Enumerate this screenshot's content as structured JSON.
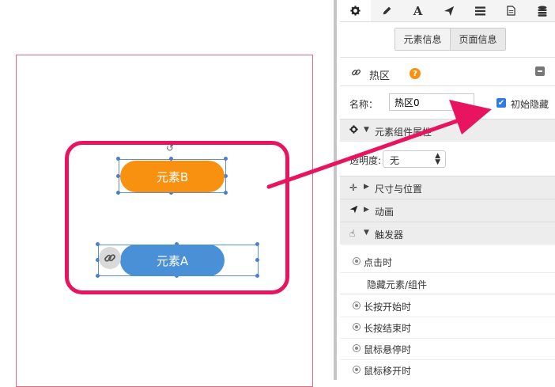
{
  "canvas": {
    "button_b": "元素B",
    "button_a": "元素A"
  },
  "panel": {
    "tabs": [
      "gear-icon",
      "pencil-icon",
      "text-icon",
      "send-icon",
      "list-icon",
      "document-icon",
      "database-icon"
    ],
    "segments": {
      "element_info": "元素信息",
      "page_info": "页面信息"
    },
    "hotspot": {
      "title": "热区",
      "help": "?"
    },
    "name": {
      "label": "名称：",
      "value": "热区0"
    },
    "initial_hidden": {
      "label": "初始隐藏",
      "checked": true
    },
    "sections": {
      "component_props": "元素组件属性",
      "size_position": "尺寸与位置",
      "animation": "动画",
      "trigger": "触发器"
    },
    "opacity": {
      "label": "透明度:",
      "value": "无"
    },
    "triggers": {
      "click": "点击时",
      "hide_action": "隐藏元素/组件",
      "long_press_start": "长按开始时",
      "long_press_end": "长按结束时",
      "hover": "鼠标悬停时",
      "leave": "鼠标移开时"
    }
  },
  "colors": {
    "accent": "#e8145f",
    "orange": "#f7910f",
    "blue": "#4a90d6",
    "checkbox": "#2f7be6"
  }
}
